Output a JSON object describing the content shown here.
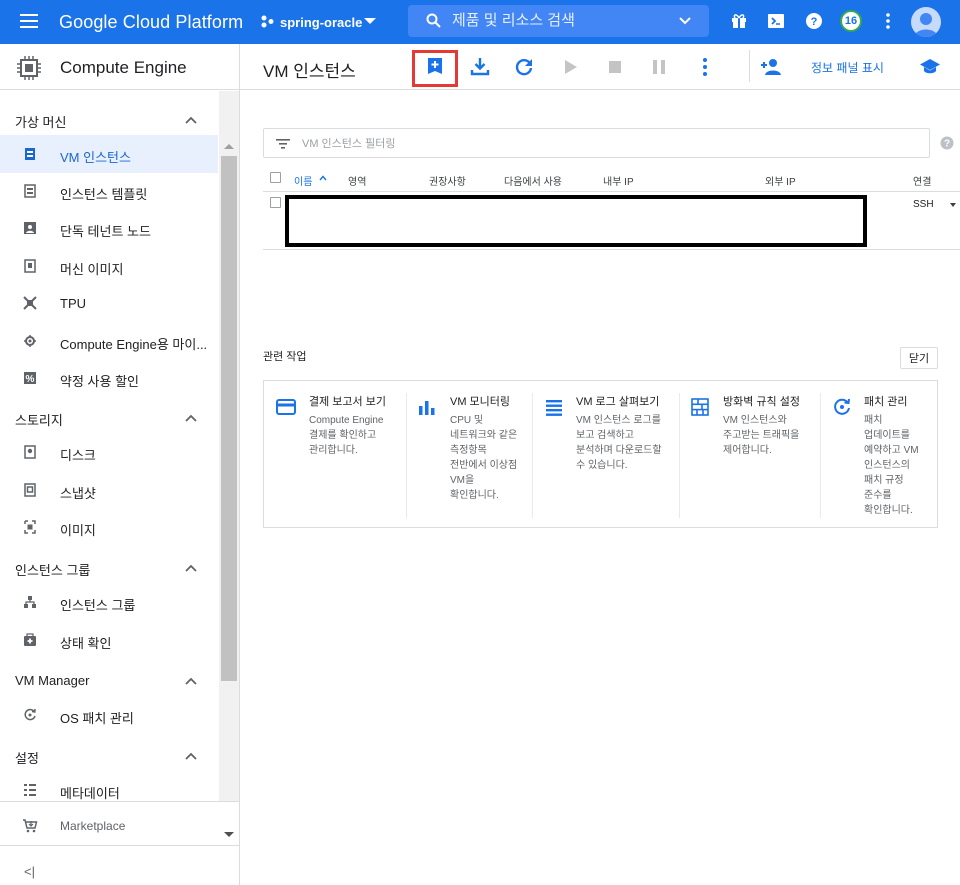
{
  "topbar": {
    "brand": "Google Cloud Platform",
    "project": "spring-oracle",
    "search_placeholder": "제품 및 리소스 검색",
    "notification_count": "16"
  },
  "sidebar": {
    "product": "Compute Engine",
    "sections": [
      {
        "label": "가상 머신"
      },
      {
        "label": "스토리지"
      },
      {
        "label": "인스턴스 그룹"
      },
      {
        "label": "VM Manager"
      },
      {
        "label": "설정"
      }
    ],
    "items": [
      {
        "label": "VM 인스턴스",
        "icon": "vm-instance-icon",
        "active": true
      },
      {
        "label": "인스턴스 템플릿",
        "icon": "instance-template-icon"
      },
      {
        "label": "단독 테넌트 노드",
        "icon": "sole-tenant-icon"
      },
      {
        "label": "머신 이미지",
        "icon": "machine-image-icon"
      },
      {
        "label": "TPU",
        "icon": "tpu-icon"
      },
      {
        "label": "Compute Engine용 마이...",
        "icon": "migrate-icon"
      },
      {
        "label": "약정 사용 할인",
        "icon": "percent-icon"
      },
      {
        "label": "디스크",
        "icon": "disk-icon"
      },
      {
        "label": "스냅샷",
        "icon": "snapshot-icon"
      },
      {
        "label": "이미지",
        "icon": "image-icon"
      },
      {
        "label": "인스턴스 그룹",
        "icon": "instance-group-icon"
      },
      {
        "label": "상태 확인",
        "icon": "health-check-icon"
      },
      {
        "label": "OS 패치 관리",
        "icon": "os-patch-icon"
      },
      {
        "label": "메타데이터",
        "icon": "metadata-icon"
      }
    ],
    "marketplace": "Marketplace",
    "collapse_label": "<|"
  },
  "toolbar": {
    "title": "VM 인스턴스",
    "info_panel": "정보 패널 표시"
  },
  "filter": {
    "placeholder": "VM 인스턴스 필터링"
  },
  "table": {
    "columns": [
      "이름",
      "영역",
      "권장사항",
      "다음에서 사용",
      "내부 IP",
      "외부 IP",
      "연결"
    ],
    "rows": [
      {
        "connect": "SSH"
      }
    ]
  },
  "related": {
    "title": "관련 작업",
    "close_label": "닫기",
    "cards": [
      {
        "title": "결제 보고서 보기",
        "desc": "Compute Engine 결제를 확인하고 관리합니다.",
        "icon": "billing-icon"
      },
      {
        "title": "VM 모니터링",
        "desc": "CPU 및 네트워크와 같은 측정항목 전반에서 이상점 VM을 확인합니다.",
        "icon": "monitoring-icon"
      },
      {
        "title": "VM 로그 살펴보기",
        "desc": "VM 인스턴스 로그를 보고 검색하고 분석하며 다운로드할 수 있습니다.",
        "icon": "logs-icon"
      },
      {
        "title": "방화벽 규칙 설정",
        "desc": "VM 인스턴스와 주고받는 트래픽을 제어합니다.",
        "icon": "firewall-icon"
      },
      {
        "title": "패치 관리",
        "desc": "패치 업데이트를 예약하고 VM 인스턴스의 패치 규정 준수를 확인합니다.",
        "icon": "patch-icon"
      }
    ]
  },
  "colors": {
    "brand": "#1a73e8",
    "highlight": "#e53935"
  }
}
